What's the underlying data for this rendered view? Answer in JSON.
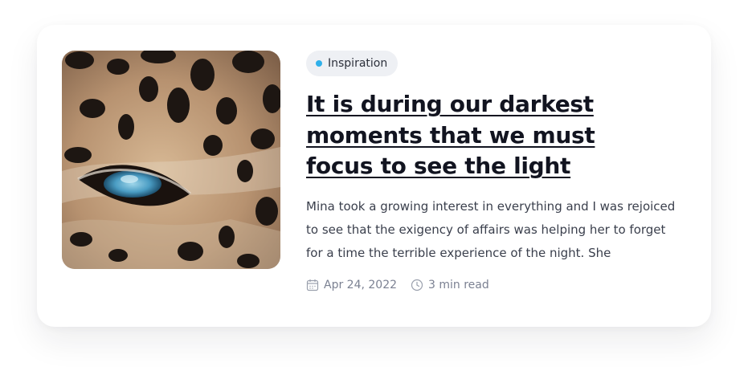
{
  "card": {
    "category": "Inspiration",
    "category_color": "#2fb0ea",
    "title": "It is during our darkest moments that we must focus to see the light",
    "excerpt": "Mina took a growing interest in everything and I was rejoiced to see that the exigency of affairs was helping her to forget for a time the terrible experience of the night. She",
    "date": "Apr 24, 2022",
    "read_time": "3 min read",
    "image_subject": "leopard-eye-closeup",
    "icons": {
      "date": "calendar-icon",
      "read_time": "clock-icon"
    }
  }
}
